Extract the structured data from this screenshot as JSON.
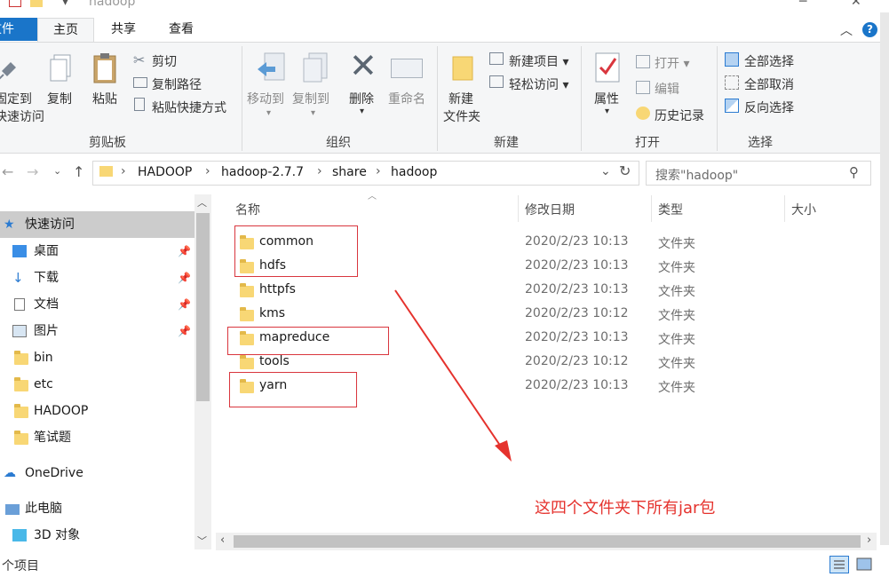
{
  "window": {
    "title": "hadoop"
  },
  "ribbon_tabs": {
    "file": "文件",
    "home": "主页",
    "share": "共享",
    "view": "查看"
  },
  "ribbon": {
    "clipboard": {
      "label": "剪贴板",
      "pin_quick_line1": "固定到",
      "pin_quick_line2": "快速访问",
      "copy": "复制",
      "paste": "粘贴",
      "cut": "剪切",
      "copy_path": "复制路径",
      "paste_shortcut": "粘贴快捷方式"
    },
    "organize": {
      "label": "组织",
      "move_to": "移动到",
      "copy_to": "复制到",
      "delete": "删除",
      "rename": "重命名"
    },
    "new": {
      "label": "新建",
      "new_folder_line1": "新建",
      "new_folder_line2": "文件夹",
      "new_item": "新建项目",
      "easy_access": "轻松访问"
    },
    "open": {
      "label": "打开",
      "properties": "属性",
      "open": "打开",
      "edit": "编辑",
      "history": "历史记录"
    },
    "select": {
      "label": "选择",
      "select_all": "全部选择",
      "select_none": "全部取消",
      "invert": "反向选择"
    }
  },
  "breadcrumb": [
    "HADOOP",
    "hadoop-2.7.7",
    "share",
    "hadoop"
  ],
  "search": {
    "placeholder": "搜索\"hadoop\""
  },
  "nav": {
    "quick_access": "快速访问",
    "items": [
      {
        "label": "桌面",
        "pinned": true
      },
      {
        "label": "下载",
        "pinned": true
      },
      {
        "label": "文档",
        "pinned": true
      },
      {
        "label": "图片",
        "pinned": true
      },
      {
        "label": "bin",
        "pinned": false
      },
      {
        "label": "etc",
        "pinned": false
      },
      {
        "label": "HADOOP",
        "pinned": false
      },
      {
        "label": "笔试题",
        "pinned": false
      }
    ],
    "onedrive": "OneDrive",
    "this_pc": "此电脑",
    "objects3d": "3D 对象"
  },
  "columns": {
    "name": "名称",
    "date": "修改日期",
    "type": "类型",
    "size": "大小"
  },
  "files": [
    {
      "name": "common",
      "date": "2020/2/23 10:13",
      "type": "文件夹"
    },
    {
      "name": "hdfs",
      "date": "2020/2/23 10:13",
      "type": "文件夹"
    },
    {
      "name": "httpfs",
      "date": "2020/2/23 10:13",
      "type": "文件夹"
    },
    {
      "name": "kms",
      "date": "2020/2/23 10:12",
      "type": "文件夹"
    },
    {
      "name": "mapreduce",
      "date": "2020/2/23 10:13",
      "type": "文件夹"
    },
    {
      "name": "tools",
      "date": "2020/2/23 10:12",
      "type": "文件夹"
    },
    {
      "name": "yarn",
      "date": "2020/2/23 10:13",
      "type": "文件夹"
    }
  ],
  "annotation": {
    "text": "这四个文件夹下所有jar包",
    "color": "#e5322d"
  },
  "status": {
    "items": "个项目"
  }
}
